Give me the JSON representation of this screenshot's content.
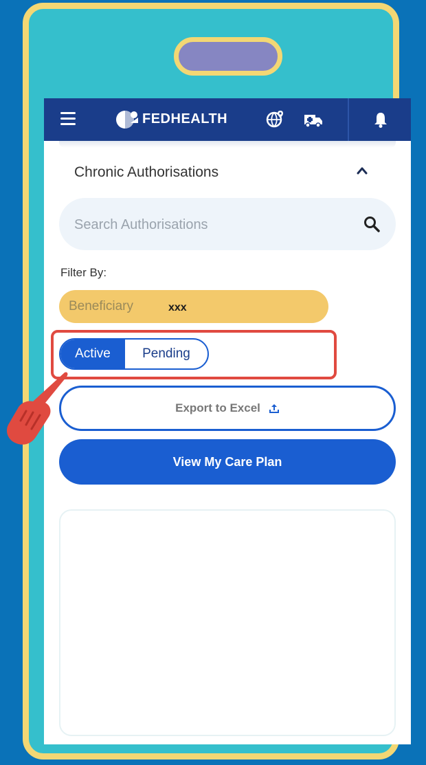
{
  "header": {
    "brand": "FEDHEALTH",
    "icons": [
      "menu-icon",
      "fedhealth-logo-icon",
      "globe-location-icon",
      "ambulance-icon",
      "bell-icon"
    ]
  },
  "section": {
    "title": "Chronic Authorisations",
    "collapse_icon": "chevron-up-icon"
  },
  "search": {
    "placeholder": "Search Authorisations",
    "value": "",
    "icon": "search-icon"
  },
  "filter": {
    "label": "Filter By:",
    "beneficiary_label": "Beneficiary",
    "beneficiary_value": "xxx",
    "status_tabs": [
      "Active",
      "Pending"
    ],
    "selected_status": "Active"
  },
  "buttons": {
    "export_label": "Export to Excel",
    "export_icon": "upload-icon",
    "care_plan_label": "View My Care Plan"
  },
  "annotation": {
    "highlight": "status-toggle",
    "pointer": "pointing-hand-icon"
  },
  "colors": {
    "page_background": "#0a72b8",
    "device_body": "#35bfcc",
    "device_frame": "#f3d774",
    "header": "#1a3d8a",
    "primary": "#1a5ed1",
    "beneficiary_chip": "#f3c96b",
    "highlight": "#e04a40"
  }
}
